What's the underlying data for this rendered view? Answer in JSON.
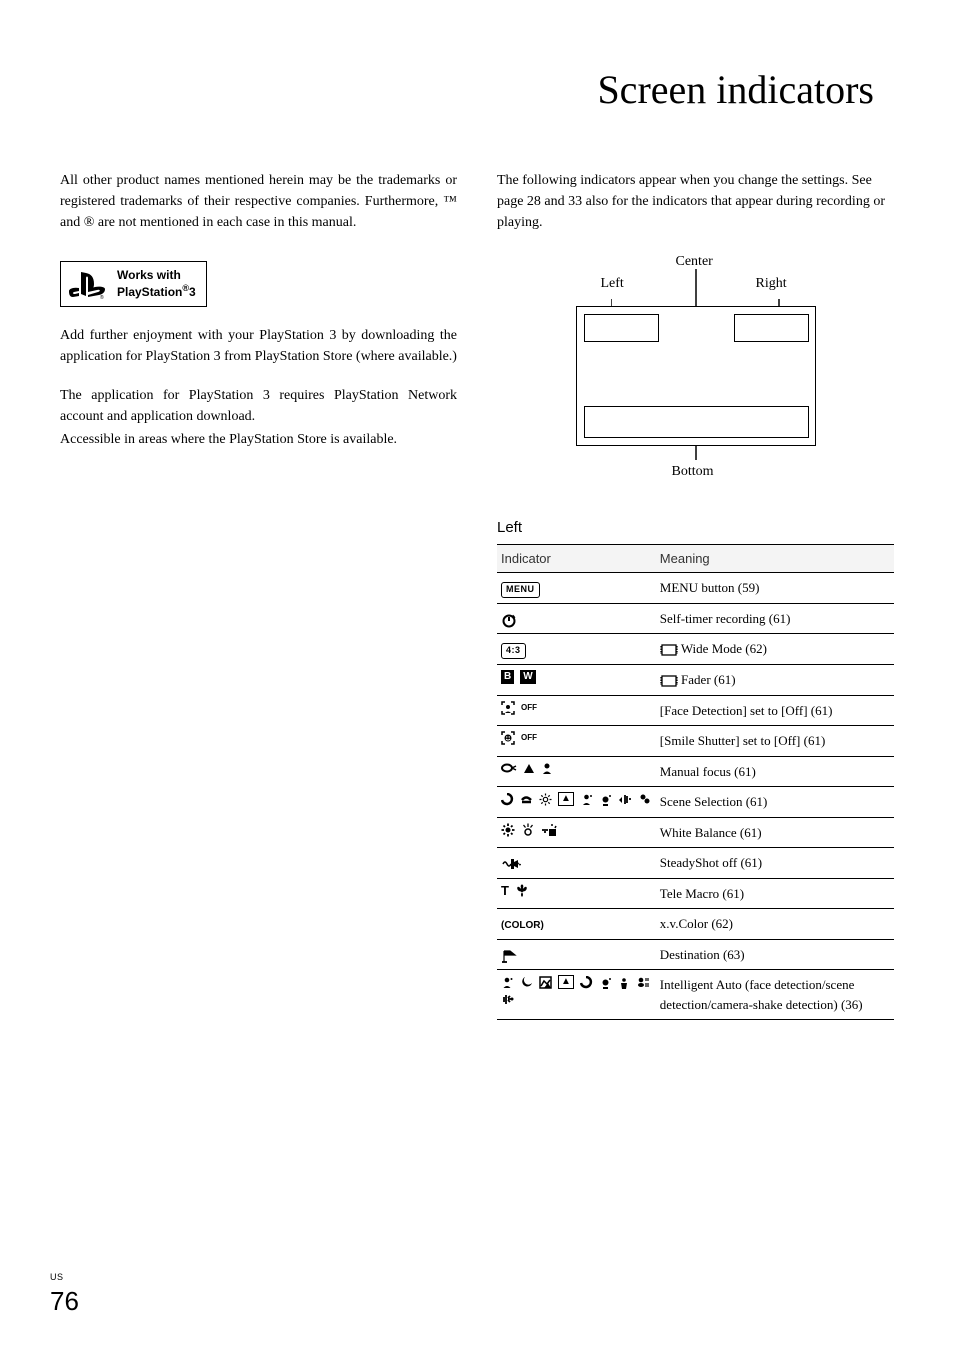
{
  "title": "Screen indicators",
  "left_para_1": "All other product names mentioned herein may be the trademarks or registered trademarks of their respective companies. Furthermore, ™ and ® are not mentioned in each case in this manual.",
  "ps3_badge_line1": "Works with",
  "ps3_badge_line2_a": "PlayStation",
  "ps3_badge_line2_b": "3",
  "left_para_2": "Add further enjoyment with your PlayStation 3 by downloading the application for PlayStation 3 from PlayStation Store (where available.)",
  "left_para_3": "The application for PlayStation 3 requires PlayStation Network account and application download.",
  "left_para_4": "Accessible in areas where the PlayStation Store is available.",
  "right_intro": "The following indicators appear when you change the settings. See page 28 and 33 also for the indicators that appear during recording or playing.",
  "diagram": {
    "center": "Center",
    "left": "Left",
    "right": "Right",
    "bottom": "Bottom"
  },
  "table_header_indicator": "Indicator",
  "table_header_meaning": "Meaning",
  "section_left": "Left",
  "rows": {
    "menu_label": "MENU",
    "menu_meaning": "MENU button (59)",
    "selftimer_meaning": "Self-timer recording (61)",
    "ratio_label": "4:3",
    "wide_meaning": "Wide Mode (62)",
    "fader_b": "B",
    "fader_w": "W",
    "fader_meaning": "Fader (61)",
    "faceoff_off": "OFF",
    "faceoff_meaning": "[Face Detection] set to [Off] (61)",
    "smileoff_off": "OFF",
    "smileoff_meaning": "[Smile Shutter] set to [Off] (61)",
    "manualfocus_meaning": "Manual focus (61)",
    "scene_meaning": "Scene Selection (61)",
    "wb_meaning": "White Balance (61)",
    "steady_meaning": "SteadyShot off (61)",
    "tele_t": "T",
    "tele_meaning": "Tele Macro (61)",
    "xvcolor_label": "COLOR",
    "xvcolor_meaning": "x.v.Color (62)",
    "dest_meaning": "Destination (63)",
    "intauto_meaning": "Intelligent Auto (face detection/scene detection/camera-shake detection) (36)"
  },
  "page": {
    "region": "US",
    "number": "76"
  }
}
